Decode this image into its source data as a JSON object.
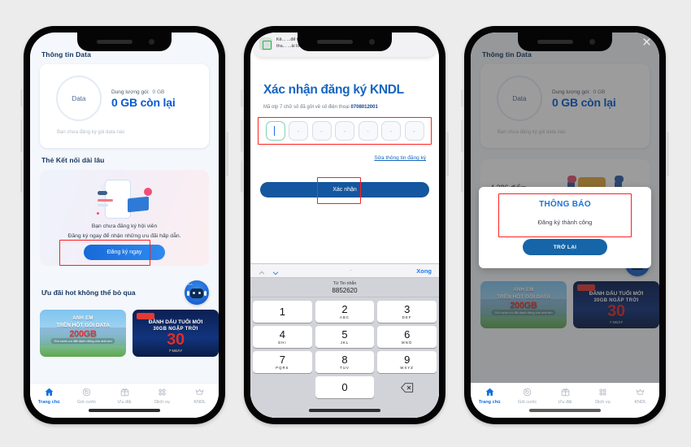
{
  "phone1": {
    "section_data_title": "Thông tin Data",
    "data_card": {
      "ring_label": "Data",
      "capacity_label": "Dung lượng gói:",
      "capacity_value": "0 GB",
      "remaining": "0 GB còn lại",
      "note": "Bạn chưa đăng ký gói data nào"
    },
    "section_card_title": "Thẻ Kết nối dài lâu",
    "promo": {
      "line1": "Bạn chưa đăng ký hội viên",
      "line2": "Đăng ký ngay để nhận những ưu đãi hấp dẫn.",
      "button": "Đăng ký ngay"
    },
    "offers_title": "Ưu đãi hot không thể bỏ qua",
    "offers": [
      {
        "line1": "ANH EM",
        "line2": "TRÊN HỘT GÓI DATA",
        "big": "200GB",
        "pill": "Gói cước ưu đãi dành riêng cho anh em"
      },
      {
        "line1": "ĐÁNH DẤU TUỔI MỚI",
        "line2": "30GB NGẬP TRỜI",
        "big": "30",
        "sub": "7 NGÀY"
      }
    ],
    "tabs": [
      {
        "label": "Trang chủ",
        "icon": "home-icon",
        "active": true
      },
      {
        "label": "Gói cước",
        "icon": "package-icon",
        "active": false
      },
      {
        "label": "Ưu đãi",
        "icon": "gift-icon",
        "active": false
      },
      {
        "label": "Dịch vụ",
        "icon": "grid-icon",
        "active": false
      },
      {
        "label": "KNDL",
        "icon": "crown-icon",
        "active": false
      }
    ]
  },
  "phone2": {
    "notification": {
      "line1": "Kê...                                        ...để trò",
      "line2": "tha...                                 ...ài lòng n...",
      "icon": "message-app-icon"
    },
    "otp": {
      "title": "Xác nhận đăng ký KNDL",
      "subtitle_prefix": "Mã otp 7 chữ số đã gửi về số điện thoại ",
      "phone_number": "0708012001",
      "boxes": [
        "",
        "-",
        "-",
        "-",
        "-",
        "-",
        "-"
      ],
      "box_count": 7,
      "edit_link": "Sửa thông tin đăng ký",
      "confirm_button": "Xác nhận"
    },
    "keyboard": {
      "done_label": "Xong",
      "dash": "-",
      "from_label": "Từ Tin nhắn",
      "from_code": "8852620",
      "keys": [
        {
          "num": "1",
          "sub": ""
        },
        {
          "num": "2",
          "sub": "ABC"
        },
        {
          "num": "3",
          "sub": "DEF"
        },
        {
          "num": "4",
          "sub": "GHI"
        },
        {
          "num": "5",
          "sub": "JKL"
        },
        {
          "num": "6",
          "sub": "MNO"
        },
        {
          "num": "7",
          "sub": "PQRS"
        },
        {
          "num": "8",
          "sub": "TUV"
        },
        {
          "num": "9",
          "sub": "WXYZ"
        },
        {
          "num": "0",
          "sub": ""
        }
      ]
    }
  },
  "phone3": {
    "section_data_title": "Thông tin Data",
    "data_card": {
      "ring_label": "Data",
      "capacity_label": "Dung lượng gói:",
      "capacity_value": "0 GB",
      "remaining": "0 GB còn lại",
      "note": "Bạn chưa đăng ký gói data nào"
    },
    "points": "4.286 điểm",
    "dialog": {
      "title": "THÔNG BÁO",
      "message": "Đăng ký thành công",
      "button": "TRỞ LẠI"
    },
    "close_icon": "close-icon",
    "offers_title": "Ưu đãi hot không thể bỏ qua",
    "offers": [
      {
        "line1": "ANH EM",
        "line2": "TRÊN HỘT GÓI DATA",
        "big": "200GB",
        "pill": "Gói cước ưu đãi dành riêng cho anh em"
      },
      {
        "line1": "ĐÁNH DẤU TUỔI MỚI",
        "line2": "30GB NGẬP TRỜI",
        "big": "30",
        "sub": "7 NGÀY"
      }
    ],
    "tabs": [
      {
        "label": "Trang chủ",
        "icon": "home-icon",
        "active": true
      },
      {
        "label": "Gói cước",
        "icon": "package-icon",
        "active": false
      },
      {
        "label": "Ưu đãi",
        "icon": "gift-icon",
        "active": false
      },
      {
        "label": "Dịch vụ",
        "icon": "grid-icon",
        "active": false
      },
      {
        "label": "KNDL",
        "icon": "crown-icon",
        "active": false
      }
    ]
  },
  "colors": {
    "background": "#ececec",
    "brand_blue": "#0a5bd3",
    "dark_blue": "#14569f",
    "highlight_red": "#ff1f1f",
    "accent_green": "#16c337"
  }
}
